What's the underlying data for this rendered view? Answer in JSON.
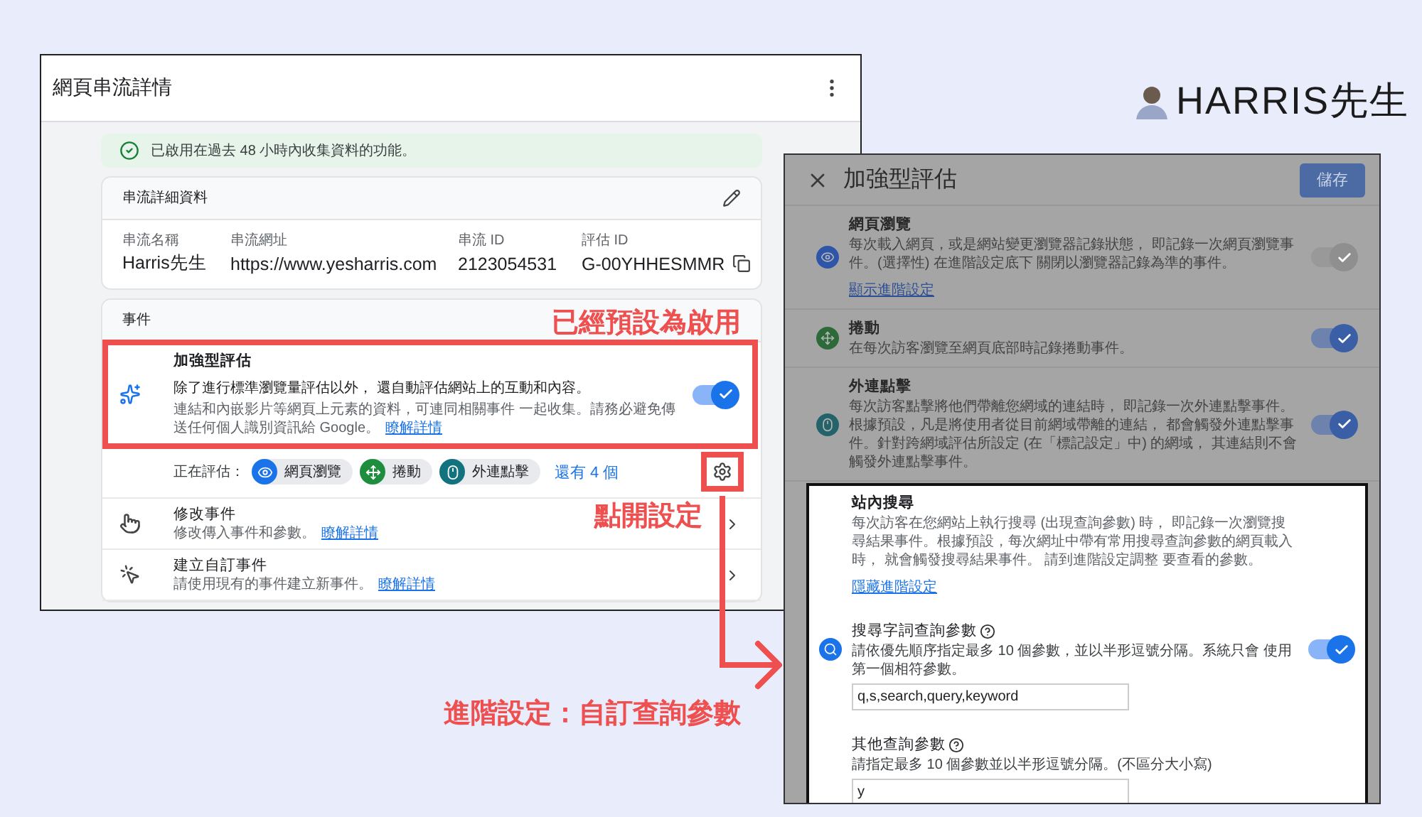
{
  "logo": {
    "text": "HARRIS先生"
  },
  "stream_window": {
    "title": "網頁串流詳情",
    "banner": "已啟用在過去 48 小時內收集資料的功能。",
    "details": {
      "title": "串流詳細資料",
      "fields": [
        {
          "label": "串流名稱",
          "value": "Harris先生"
        },
        {
          "label": "串流網址",
          "value": "https://www.yesharris.com"
        },
        {
          "label": "串流 ID",
          "value": "2123054531"
        },
        {
          "label": "評估 ID",
          "value": "G-00YHHESMMR"
        }
      ]
    },
    "events": {
      "title": "事件",
      "enhanced": {
        "title": "加強型評估",
        "description": "除了進行標準瀏覽量評估以外， 還自動評估網站上的互動和內容。",
        "note": "連結和內嵌影片等網頁上元素的資料，可連同相關事件 一起收集。請務必避免傳送任何個人識別資訊給 Google。",
        "link": "瞭解詳情",
        "on": true
      },
      "measuring_label": "正在評估：",
      "chips": [
        {
          "kind": "eye",
          "label": "網頁瀏覽",
          "color": "#1a73e8"
        },
        {
          "kind": "move",
          "label": "捲動",
          "color": "#1e8e3e"
        },
        {
          "kind": "mouse",
          "label": "外連點擊",
          "color": "#12737e"
        }
      ],
      "more": "還有 4 個",
      "items": [
        {
          "kind": "modify",
          "title": "修改事件",
          "description": "修改傳入事件和參數。",
          "link": "瞭解詳情"
        },
        {
          "kind": "create",
          "title": "建立自訂事件",
          "description": "請使用現有的事件建立新事件。",
          "link": "瞭解詳情"
        }
      ]
    }
  },
  "enhanced_window": {
    "title": "加強型評估",
    "save": "儲存",
    "settings": [
      {
        "kind": "eye",
        "color": "#2f55a8",
        "title": "網頁瀏覽",
        "description": "每次載入網頁，或是網站變更瀏覽器記錄狀態， 即記錄一次網頁瀏覽事件。(選擇性) 在進階設定底下 關閉以瀏覽器記錄為準的事件。",
        "link": "顯示進階設定",
        "on": true,
        "disabled": true,
        "highlighted": false
      },
      {
        "kind": "move",
        "color": "#2d6a3a",
        "title": "捲動",
        "description": "在每次訪客瀏覽至網頁底部時記錄捲動事件。",
        "on": true,
        "disabled": false,
        "highlighted": false
      },
      {
        "kind": "mouse",
        "color": "#24636a",
        "title": "外連點擊",
        "description": "每次訪客點擊將他們帶離您網域的連結時， 即記錄一次外連點擊事件。根據預設，凡是將使用者從目前網域帶離的連結， 都會觸發外連點擊事件。針對跨網域評估所設定 (在「標記設定」中) 的網域， 其連結則不會觸發外連點擊事件。",
        "on": true,
        "disabled": false,
        "highlighted": false
      },
      {
        "kind": "search",
        "color": "#1a73e8",
        "title": "站內搜尋",
        "description": "每次訪客在您網站上執行搜尋 (出現查詢參數) 時， 即記錄一次瀏覽搜尋結果事件。根據預設，每次網址中帶有常用搜尋查詢參數的網頁載入時， 就會觸發搜尋結果事件。 請到進階設定調整 要查看的參數。",
        "link": "隱藏進階設定",
        "on": true,
        "disabled": false,
        "highlighted": true,
        "params": [
          {
            "label": "搜尋字詞查詢參數",
            "description": "請依優先順序指定最多 10 個參數，並以半形逗號分隔。系統只會 使用第一個相符參數。",
            "value": "q,s,search,query,keyword"
          },
          {
            "label": "其他查詢參數",
            "description": "請指定最多 10 個參數並以半形逗號分隔。(不區分大小寫)",
            "value": "y"
          }
        ]
      }
    ]
  },
  "annotations": {
    "enabled_note": "已經預設為啟用",
    "open_settings_note": "點開設定",
    "advanced_note": "進階設定：自訂查詢參數"
  }
}
